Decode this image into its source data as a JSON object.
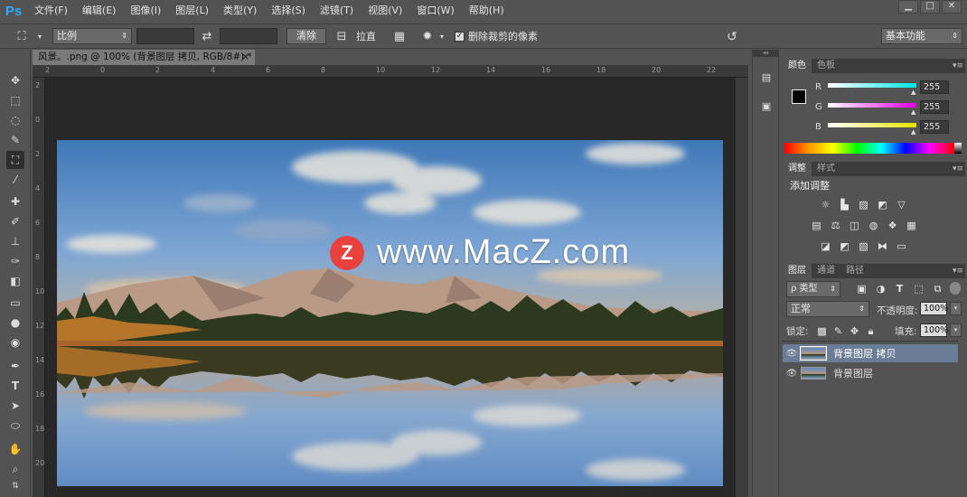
{
  "app": {
    "logo": "Ps"
  },
  "menu": [
    "文件(F)",
    "编辑(E)",
    "图像(I)",
    "图层(L)",
    "类型(Y)",
    "选择(S)",
    "滤镜(T)",
    "视图(V)",
    "窗口(W)",
    "帮助(H)"
  ],
  "window_controls": {
    "minimize": "▁",
    "restore": "□",
    "close": "✕"
  },
  "options": {
    "ratio_select": "比例",
    "clear_button": "清除",
    "straighten_label": "拉直",
    "delete_cropped_label": "删除裁剪的像素",
    "delete_cropped_checked": true,
    "workspace_select": "基本功能"
  },
  "document": {
    "tab_title": "风景。.png @ 100% (背景图层 拷贝, RGB/8#) *",
    "tab_close": "×",
    "ruler_top": [
      "2",
      "0",
      "2",
      "4",
      "6",
      "8",
      "10",
      "12",
      "14",
      "16",
      "18",
      "20",
      "22"
    ],
    "ruler_left": [
      "2",
      "0",
      "2",
      "4",
      "6",
      "8",
      "10",
      "12",
      "14",
      "16",
      "18",
      "20"
    ]
  },
  "watermark": {
    "logo": "Z",
    "text": "www.MacZ.com"
  },
  "panels": {
    "color": {
      "tabs": [
        "颜色",
        "色板"
      ],
      "channels": [
        {
          "name": "R",
          "value": "255",
          "color": "#00e5e5"
        },
        {
          "name": "G",
          "value": "255",
          "color": "#e500e5"
        },
        {
          "name": "B",
          "value": "255",
          "color": "#e5e500"
        }
      ],
      "foreground": "#000000",
      "background": "#ffffff"
    },
    "adjustments": {
      "tabs": [
        "调整",
        "样式"
      ],
      "title": "添加调整"
    },
    "layers": {
      "tabs": [
        "图层",
        "通道",
        "路径"
      ],
      "filter_select": "ρ 类型",
      "blend_mode": "正常",
      "opacity_label": "不透明度:",
      "opacity": "100%",
      "lock_label": "锁定:",
      "fill_label": "填充:",
      "fill": "100%",
      "items": [
        {
          "name": "背景图层 拷贝",
          "selected": true
        },
        {
          "name": "背景图层",
          "selected": false
        }
      ]
    }
  }
}
